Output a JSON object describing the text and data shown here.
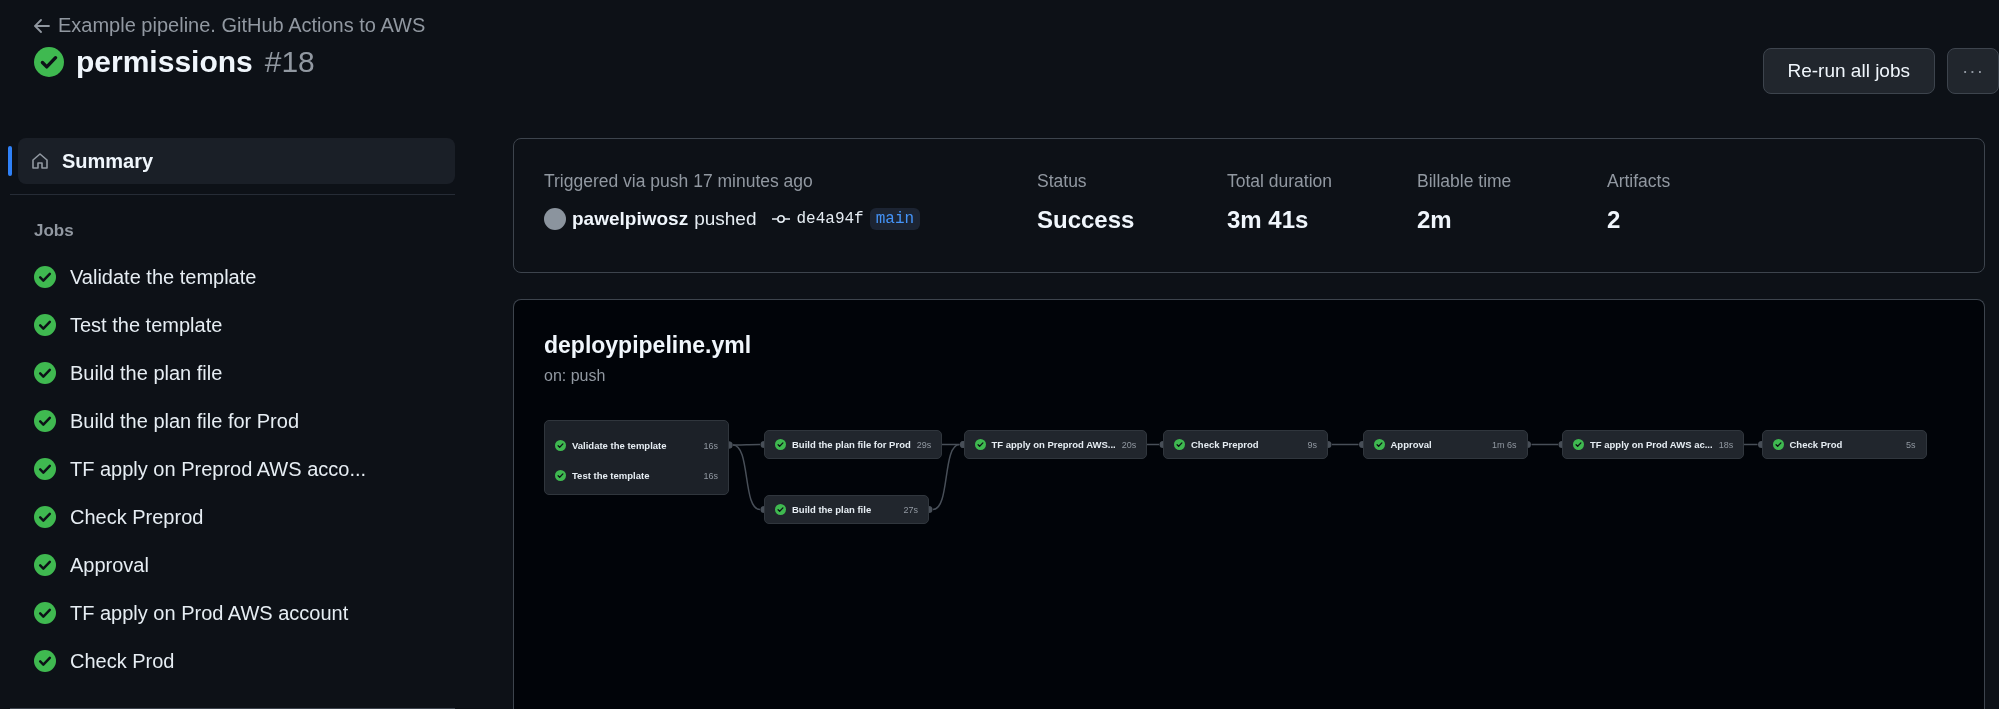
{
  "back_link": "Example pipeline. GitHub Actions to AWS",
  "run": {
    "passed": true,
    "title": "permissions",
    "number": "#18"
  },
  "actions": {
    "rerun": "Re-run all jobs",
    "more": "···"
  },
  "sidebar": {
    "summary": {
      "label": "Summary",
      "selected": true
    },
    "jobs_heading": "Jobs",
    "jobs": [
      {
        "label": "Validate the template",
        "passed": true
      },
      {
        "label": "Test the template",
        "passed": true
      },
      {
        "label": "Build the plan file",
        "passed": true
      },
      {
        "label": "Build the plan file for Prod",
        "passed": true
      },
      {
        "label": "TF apply on Preprod AWS acco...",
        "passed": true
      },
      {
        "label": "Check Preprod",
        "passed": true
      },
      {
        "label": "Approval",
        "passed": true
      },
      {
        "label": "TF apply on Prod AWS account",
        "passed": true
      },
      {
        "label": "Check Prod",
        "passed": true
      }
    ]
  },
  "summary": {
    "trigger": "Triggered via push 17 minutes ago",
    "user": "pawelpiwosz",
    "action": "pushed",
    "commit": "de4a94f",
    "branch": "main",
    "stats": [
      {
        "label": "Status",
        "value": "Success"
      },
      {
        "label": "Total duration",
        "value": "3m 41s"
      },
      {
        "label": "Billable time",
        "value": "2m"
      },
      {
        "label": "Artifacts",
        "value": "2"
      }
    ]
  },
  "workflow": {
    "file": "deploypipeline.yml",
    "event": "on: push",
    "columns": [
      {
        "kind": "group",
        "jobs": [
          {
            "label": "Validate the template",
            "time": "16s",
            "passed": true
          },
          {
            "label": "Test the template",
            "time": "16s",
            "passed": true
          }
        ]
      },
      {
        "kind": "parallel",
        "jobs": [
          {
            "label": "Build the plan file for Prod",
            "time": "29s",
            "passed": true
          },
          {
            "label": "Build the plan file",
            "time": "27s",
            "passed": true
          }
        ]
      },
      {
        "kind": "parallel",
        "jobs": [
          {
            "label": "TF apply on Preprod AWS...",
            "time": "20s",
            "passed": true
          }
        ]
      },
      {
        "kind": "parallel",
        "jobs": [
          {
            "label": "Check Preprod",
            "time": "9s",
            "passed": true
          }
        ]
      },
      {
        "kind": "parallel",
        "jobs": [
          {
            "label": "Approval",
            "time": "1m 6s",
            "passed": true
          }
        ]
      },
      {
        "kind": "parallel",
        "jobs": [
          {
            "label": "TF apply on Prod AWS ac...",
            "time": "18s",
            "passed": true
          }
        ]
      },
      {
        "kind": "parallel",
        "jobs": [
          {
            "label": "Check Prod",
            "time": "5s",
            "passed": true
          }
        ]
      }
    ]
  }
}
